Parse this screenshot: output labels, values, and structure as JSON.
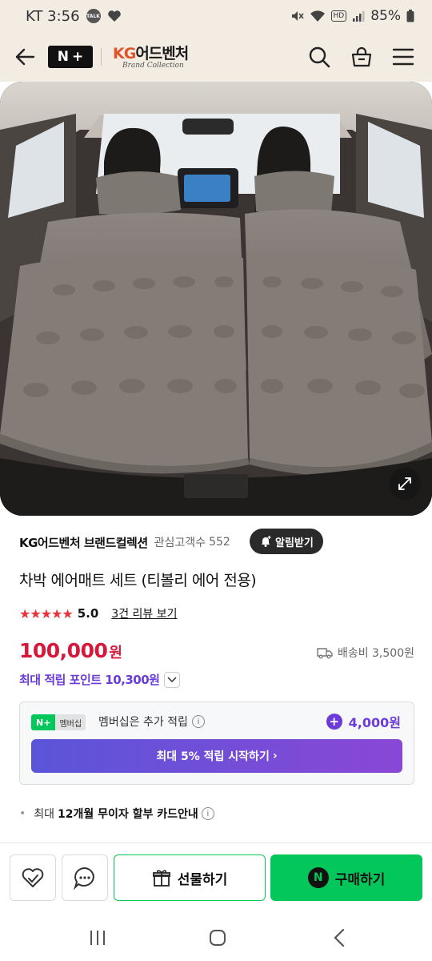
{
  "status_bar": {
    "carrier_time": "KT 3:56",
    "talk_label": "TALK",
    "hd_label": "HD",
    "battery": "85%"
  },
  "header": {
    "np_logo_n": "N",
    "np_logo_plus": "+",
    "brand_name_kg": "KG",
    "brand_name_rest": "어드벤처",
    "brand_sub": "Brand Collection"
  },
  "store": {
    "name": "KG어드벤처 브랜드컬렉션",
    "follower_label": "관심고객수",
    "follower_count": "552",
    "alarm_button": "알림받기"
  },
  "product": {
    "title": "차박 에어매트 세트 (티볼리 에어 전용)",
    "stars": "★★★★★",
    "rating": "5.0",
    "review_link": "3건 리뷰 보기",
    "price": "100,000",
    "currency": "원",
    "shipping": "배송비 3,500원",
    "points": "최대 적립 포인트 10,300원"
  },
  "membership": {
    "badge_np": "N+",
    "badge_label": "멤버십",
    "text": "멤버십은 추가 적립",
    "points": "4,000원",
    "cta": "최대 5% 적립 시작하기",
    "cta_arrow": "›"
  },
  "installment": {
    "prefix": "최대",
    "bold": "12개월 무이자 할부 카드안내"
  },
  "bottom_bar": {
    "gift_label": "선물하기",
    "buy_n": "N",
    "buy_label": "구매하기"
  },
  "colors": {
    "header_bg": "#f2ece3",
    "price_red": "#d8183a",
    "points_purple": "#6b3cd8",
    "naver_green": "#03c75a"
  }
}
